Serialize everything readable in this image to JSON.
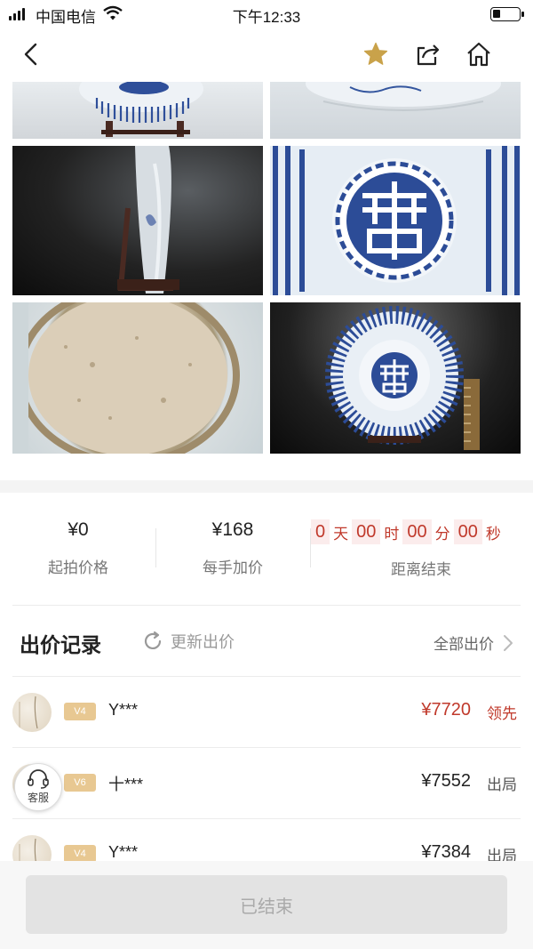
{
  "status_bar": {
    "carrier": "中国电信",
    "time": "下午12:33",
    "battery_level": 0.3
  },
  "nav": {
    "back_icon": "chevron-left-icon",
    "favorite_icon": "star-icon",
    "share_icon": "share-icon",
    "home_icon": "home-icon",
    "favorite_color": "#c9a24a"
  },
  "pricing": {
    "start_price_value": "¥0",
    "start_price_label": "起拍价格",
    "increment_value": "¥168",
    "increment_label": "每手加价",
    "countdown": {
      "days": "0",
      "days_unit": "天",
      "hours": "00",
      "hours_unit": "时",
      "minutes": "00",
      "minutes_unit": "分",
      "seconds": "00",
      "seconds_unit": "秒",
      "label": "距离结束"
    }
  },
  "bid_record": {
    "title": "出价记录",
    "refresh_label": "更新出价",
    "all_bids_label": "全部出价",
    "rows": [
      {
        "level": "V4",
        "bidder": "Y***",
        "amount": "¥7720",
        "state": "领先"
      },
      {
        "level": "V6",
        "bidder": "十***",
        "amount": "¥7552",
        "state": "出局"
      },
      {
        "level": "V4",
        "bidder": "Y***",
        "amount": "¥7384",
        "state": "出局"
      }
    ]
  },
  "customer_service": {
    "label": "客服",
    "icon": "headset-icon"
  },
  "footer": {
    "ended_label": "已结束"
  },
  "colors": {
    "accent_red": "#c0392b",
    "level_badge": "#e8c892"
  }
}
